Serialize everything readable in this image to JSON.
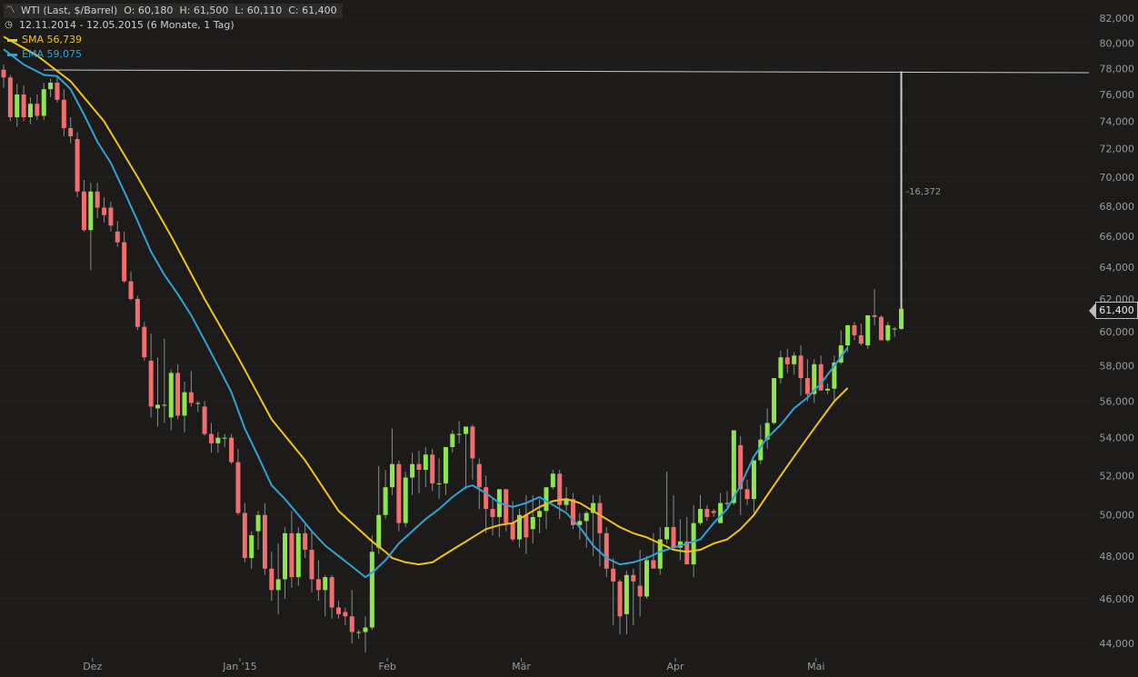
{
  "legend": {
    "instrument": "WTI (Last, $/Barrel)",
    "open": "O: 60,180",
    "high": "H: 61,500",
    "low": "L: 60,110",
    "close": "C: 61,400",
    "period": "12.11.2014 - 12.05.2015 (6 Monate, 1 Tag)",
    "sma_label": "SMA",
    "sma_value": "56,739",
    "ema_label": "EMA",
    "ema_value": "59,075"
  },
  "current_price_label": "61,400",
  "drawdown_label": "-16,372",
  "chart_data": {
    "type": "candlestick",
    "ylim": [
      43.5,
      82.5
    ],
    "y_scale": "log",
    "y_ticks": [
      "82,000",
      "80,000",
      "78,000",
      "76,000",
      "74,000",
      "72,000",
      "70,000",
      "68,000",
      "66,000",
      "64,000",
      "62,000",
      "60,000",
      "58,000",
      "56,000",
      "54,000",
      "52,000",
      "50,000",
      "48,000",
      "46,000",
      "44,000"
    ],
    "y_tick_values": [
      82,
      80,
      78,
      76,
      74,
      72,
      70,
      68,
      66,
      64,
      62,
      60,
      58,
      56,
      54,
      52,
      50,
      48,
      46,
      44
    ],
    "x_ticks": [
      {
        "label": "Dez",
        "index": 13
      },
      {
        "label": "Jan '15",
        "index": 35
      },
      {
        "label": "Feb",
        "index": 57
      },
      {
        "label": "Mär",
        "index": 77
      },
      {
        "label": "Apr",
        "index": 100
      },
      {
        "label": "Mai",
        "index": 121
      }
    ],
    "reference_level": 77.772,
    "last_close": 61.4,
    "drawdown": -16.372,
    "colors": {
      "up": "#8ee54e",
      "down": "#f26d6d",
      "sma": "#f0c21c",
      "ema": "#2fa3d6",
      "grid": "#333",
      "ref": "#c9c9c9"
    },
    "ohlc": [
      [
        77.9,
        78.3,
        76.5,
        77.3
      ],
      [
        77.3,
        77.5,
        74.0,
        74.3
      ],
      [
        74.3,
        76.8,
        73.6,
        76.0
      ],
      [
        76.0,
        76.7,
        74.0,
        74.3
      ],
      [
        74.3,
        75.8,
        73.8,
        75.3
      ],
      [
        75.3,
        76.0,
        74.1,
        74.4
      ],
      [
        74.4,
        76.9,
        74.1,
        76.4
      ],
      [
        76.4,
        77.2,
        75.8,
        76.9
      ],
      [
        76.9,
        77.4,
        75.4,
        75.6
      ],
      [
        75.6,
        76.4,
        72.9,
        73.5
      ],
      [
        73.5,
        74.3,
        72.4,
        72.9
      ],
      [
        72.7,
        73.2,
        68.6,
        69.0
      ],
      [
        69.0,
        69.8,
        66.3,
        66.4
      ],
      [
        66.4,
        69.6,
        63.8,
        69.0
      ],
      [
        69.0,
        69.6,
        67.2,
        67.9
      ],
      [
        67.9,
        68.6,
        66.9,
        67.4
      ],
      [
        67.9,
        68.3,
        66.3,
        66.7
      ],
      [
        66.3,
        67.0,
        65.3,
        65.6
      ],
      [
        65.6,
        66.3,
        63.0,
        63.1
      ],
      [
        63.1,
        63.7,
        61.9,
        62.0
      ],
      [
        62.0,
        62.2,
        60.1,
        60.3
      ],
      [
        60.3,
        60.6,
        58.3,
        58.5
      ],
      [
        58.3,
        59.9,
        55.1,
        55.7
      ],
      [
        55.6,
        58.5,
        54.6,
        55.8
      ],
      [
        55.8,
        59.6,
        54.8,
        55.8
      ],
      [
        55.1,
        57.8,
        54.4,
        57.6
      ],
      [
        57.6,
        58.1,
        55.0,
        55.2
      ],
      [
        55.2,
        57.1,
        54.3,
        56.5
      ],
      [
        56.5,
        57.7,
        55.7,
        55.9
      ],
      [
        55.9,
        56.0,
        55.4,
        55.9
      ],
      [
        55.7,
        56.0,
        54.1,
        54.2
      ],
      [
        54.2,
        54.8,
        53.2,
        53.7
      ],
      [
        53.7,
        54.3,
        53.2,
        54.0
      ],
      [
        54.0,
        54.2,
        53.5,
        54.0
      ],
      [
        54.0,
        54.2,
        52.6,
        52.7
      ],
      [
        52.7,
        53.4,
        50.0,
        50.1
      ],
      [
        50.1,
        50.6,
        47.7,
        47.9
      ],
      [
        47.9,
        49.2,
        47.4,
        49.0
      ],
      [
        49.2,
        50.2,
        48.3,
        50.0
      ],
      [
        50.0,
        50.6,
        47.1,
        47.4
      ],
      [
        47.4,
        48.2,
        45.9,
        46.4
      ],
      [
        46.4,
        48.6,
        45.3,
        46.9
      ],
      [
        46.9,
        49.4,
        46.0,
        49.1
      ],
      [
        49.1,
        50.2,
        46.5,
        47.0
      ],
      [
        47.0,
        49.4,
        46.6,
        49.1
      ],
      [
        49.1,
        49.6,
        47.9,
        48.3
      ],
      [
        48.3,
        49.2,
        46.3,
        46.9
      ],
      [
        46.9,
        47.8,
        45.9,
        46.4
      ],
      [
        46.4,
        47.1,
        45.2,
        47.0
      ],
      [
        47.0,
        47.1,
        45.1,
        45.6
      ],
      [
        45.6,
        45.9,
        45.1,
        45.3
      ],
      [
        45.4,
        45.6,
        44.8,
        45.2
      ],
      [
        45.2,
        46.4,
        44.0,
        44.5
      ],
      [
        44.5,
        44.6,
        44.2,
        44.5
      ],
      [
        44.5,
        45.2,
        43.6,
        44.7
      ],
      [
        44.7,
        49.0,
        44.6,
        48.2
      ],
      [
        48.4,
        52.5,
        48.1,
        50.0
      ],
      [
        50.0,
        52.3,
        49.8,
        51.4
      ],
      [
        51.4,
        54.5,
        51.0,
        52.6
      ],
      [
        52.6,
        52.8,
        49.2,
        49.6
      ],
      [
        49.6,
        52.2,
        49.4,
        51.9
      ],
      [
        51.9,
        53.2,
        51.0,
        52.6
      ],
      [
        52.6,
        53.3,
        51.1,
        52.3
      ],
      [
        52.3,
        53.5,
        51.4,
        53.1
      ],
      [
        53.1,
        53.4,
        51.2,
        51.6
      ],
      [
        51.6,
        52.9,
        50.8,
        51.6
      ],
      [
        51.6,
        52.9,
        51.0,
        53.5
      ],
      [
        53.5,
        54.4,
        53.2,
        54.2
      ],
      [
        54.2,
        54.9,
        53.7,
        54.2
      ],
      [
        54.2,
        54.4,
        51.3,
        54.6
      ],
      [
        54.6,
        54.7,
        51.8,
        52.9
      ],
      [
        52.6,
        52.9,
        50.3,
        51.4
      ],
      [
        51.4,
        52.0,
        49.1,
        50.3
      ],
      [
        50.3,
        50.9,
        49.0,
        49.9
      ],
      [
        49.9,
        51.1,
        48.9,
        51.3
      ],
      [
        51.3,
        51.3,
        49.2,
        49.6
      ],
      [
        49.6,
        50.7,
        48.7,
        48.8
      ],
      [
        48.8,
        50.3,
        48.4,
        50.0
      ],
      [
        50.0,
        51.0,
        48.1,
        48.9
      ],
      [
        49.3,
        51.0,
        48.6,
        49.9
      ],
      [
        49.9,
        50.8,
        49.1,
        50.2
      ],
      [
        50.2,
        51.3,
        49.3,
        51.4
      ],
      [
        51.4,
        52.3,
        51.3,
        52.1
      ],
      [
        52.1,
        52.3,
        49.8,
        50.5
      ],
      [
        50.5,
        51.4,
        50.2,
        50.8
      ],
      [
        50.8,
        51.1,
        49.3,
        49.5
      ],
      [
        49.5,
        50.1,
        48.8,
        49.7
      ],
      [
        49.7,
        50.2,
        48.4,
        50.1
      ],
      [
        50.1,
        51.0,
        48.0,
        50.6
      ],
      [
        50.6,
        51.0,
        47.5,
        49.1
      ],
      [
        49.1,
        49.4,
        47.0,
        47.4
      ],
      [
        47.4,
        47.9,
        44.8,
        46.8
      ],
      [
        46.8,
        46.9,
        44.4,
        45.2
      ],
      [
        45.3,
        47.3,
        44.4,
        47.1
      ],
      [
        47.1,
        47.4,
        44.8,
        46.8
      ],
      [
        46.6,
        48.3,
        45.2,
        46.1
      ],
      [
        46.1,
        48.0,
        46.0,
        47.8
      ],
      [
        47.8,
        49.1,
        47.5,
        47.4
      ],
      [
        47.4,
        49.4,
        47.1,
        48.8
      ],
      [
        48.8,
        52.2,
        48.6,
        49.4
      ],
      [
        49.4,
        51.0,
        48.6,
        48.4
      ],
      [
        48.4,
        49.8,
        47.8,
        48.7
      ],
      [
        48.7,
        49.9,
        47.7,
        47.6
      ],
      [
        47.6,
        50.5,
        47.0,
        49.6
      ],
      [
        49.6,
        51.0,
        49.5,
        50.3
      ],
      [
        50.3,
        50.5,
        49.7,
        49.9
      ],
      [
        50.2,
        50.3,
        49.9,
        50.1
      ],
      [
        49.6,
        51.1,
        49.6,
        50.6
      ],
      [
        50.6,
        51.2,
        50.4,
        50.6
      ],
      [
        50.6,
        54.2,
        50.5,
        54.4
      ],
      [
        53.6,
        54.1,
        50.0,
        51.3
      ],
      [
        51.3,
        51.8,
        50.5,
        50.8
      ],
      [
        50.8,
        51.2,
        50.1,
        52.8
      ],
      [
        52.8,
        54.7,
        52.6,
        53.9
      ],
      [
        53.9,
        55.6,
        53.4,
        54.8
      ],
      [
        54.8,
        56.4,
        54.7,
        57.3
      ],
      [
        57.3,
        58.9,
        57.0,
        58.5
      ],
      [
        58.5,
        59.0,
        57.6,
        58.1
      ],
      [
        58.1,
        58.8,
        57.5,
        58.6
      ],
      [
        58.6,
        59.2,
        56.3,
        57.3
      ],
      [
        57.3,
        58.4,
        56.0,
        56.4
      ],
      [
        56.4,
        58.4,
        55.9,
        58.1
      ],
      [
        58.1,
        58.6,
        56.8,
        56.6
      ],
      [
        56.6,
        57.0,
        56.4,
        56.7
      ],
      [
        56.7,
        58.6,
        56.0,
        58.2
      ],
      [
        58.2,
        60.1,
        58.1,
        59.2
      ],
      [
        59.2,
        60.3,
        58.8,
        60.4
      ],
      [
        60.4,
        60.6,
        59.5,
        59.8
      ],
      [
        59.8,
        60.5,
        59.2,
        59.3
      ],
      [
        59.2,
        61.0,
        59.0,
        61.0
      ],
      [
        61.0,
        62.6,
        60.4,
        60.9
      ],
      [
        60.9,
        61.0,
        59.5,
        59.5
      ],
      [
        59.5,
        60.6,
        59.4,
        60.4
      ],
      [
        60.2,
        60.3,
        59.7,
        60.2
      ],
      [
        60.18,
        61.5,
        60.11,
        61.4
      ]
    ],
    "sma": [
      [
        0,
        80.5
      ],
      [
        5,
        79.0
      ],
      [
        10,
        77.0
      ],
      [
        15,
        74.0
      ],
      [
        20,
        70.0
      ],
      [
        25,
        66.0
      ],
      [
        30,
        62.0
      ],
      [
        35,
        58.5
      ],
      [
        40,
        55.0
      ],
      [
        45,
        52.8
      ],
      [
        50,
        50.2
      ],
      [
        52,
        49.6
      ],
      [
        55,
        48.7
      ],
      [
        57,
        48.2
      ],
      [
        58,
        47.9
      ],
      [
        60,
        47.7
      ],
      [
        62,
        47.6
      ],
      [
        64,
        47.7
      ],
      [
        66,
        48.1
      ],
      [
        68,
        48.5
      ],
      [
        70,
        48.9
      ],
      [
        72,
        49.3
      ],
      [
        74,
        49.5
      ],
      [
        76,
        49.6
      ],
      [
        78,
        50.0
      ],
      [
        80,
        50.4
      ],
      [
        82,
        50.7
      ],
      [
        84,
        50.8
      ],
      [
        86,
        50.6
      ],
      [
        88,
        50.2
      ],
      [
        90,
        49.8
      ],
      [
        92,
        49.4
      ],
      [
        94,
        49.1
      ],
      [
        96,
        48.9
      ],
      [
        98,
        48.6
      ],
      [
        100,
        48.3
      ],
      [
        102,
        48.2
      ],
      [
        104,
        48.3
      ],
      [
        106,
        48.6
      ],
      [
        108,
        48.8
      ],
      [
        110,
        49.3
      ],
      [
        112,
        50.0
      ],
      [
        114,
        51.0
      ],
      [
        116,
        52.0
      ],
      [
        118,
        53.0
      ],
      [
        120,
        54.0
      ],
      [
        122,
        55.0
      ],
      [
        124,
        56.0
      ],
      [
        126,
        56.739
      ]
    ],
    "ema": [
      [
        0,
        79.5
      ],
      [
        3,
        78.3
      ],
      [
        6,
        77.5
      ],
      [
        8,
        77.4
      ],
      [
        10,
        76.4
      ],
      [
        12,
        74.5
      ],
      [
        14,
        72.5
      ],
      [
        16,
        71.0
      ],
      [
        18,
        69.0
      ],
      [
        20,
        67.0
      ],
      [
        22,
        65.0
      ],
      [
        24,
        63.5
      ],
      [
        26,
        62.3
      ],
      [
        28,
        61.0
      ],
      [
        30,
        59.5
      ],
      [
        32,
        58.0
      ],
      [
        34,
        56.5
      ],
      [
        36,
        54.5
      ],
      [
        38,
        53.0
      ],
      [
        40,
        51.5
      ],
      [
        42,
        50.8
      ],
      [
        44,
        50.0
      ],
      [
        46,
        49.2
      ],
      [
        48,
        48.5
      ],
      [
        50,
        48.0
      ],
      [
        52,
        47.5
      ],
      [
        54,
        47.0
      ],
      [
        55,
        47.2
      ],
      [
        57,
        47.8
      ],
      [
        59,
        48.6
      ],
      [
        61,
        49.2
      ],
      [
        63,
        49.8
      ],
      [
        65,
        50.3
      ],
      [
        67,
        50.9
      ],
      [
        69,
        51.4
      ],
      [
        70,
        51.5
      ],
      [
        72,
        51.1
      ],
      [
        74,
        50.6
      ],
      [
        76,
        50.4
      ],
      [
        78,
        50.6
      ],
      [
        80,
        50.9
      ],
      [
        82,
        50.5
      ],
      [
        84,
        50.1
      ],
      [
        86,
        49.4
      ],
      [
        88,
        48.5
      ],
      [
        90,
        47.9
      ],
      [
        92,
        47.6
      ],
      [
        94,
        47.7
      ],
      [
        96,
        47.9
      ],
      [
        98,
        48.2
      ],
      [
        100,
        48.4
      ],
      [
        102,
        48.6
      ],
      [
        104,
        48.8
      ],
      [
        106,
        49.6
      ],
      [
        108,
        50.3
      ],
      [
        110,
        51.5
      ],
      [
        112,
        53.0
      ],
      [
        114,
        54.0
      ],
      [
        116,
        54.7
      ],
      [
        118,
        55.6
      ],
      [
        120,
        56.2
      ],
      [
        122,
        57.0
      ],
      [
        124,
        58.0
      ],
      [
        126,
        59.075
      ]
    ]
  }
}
